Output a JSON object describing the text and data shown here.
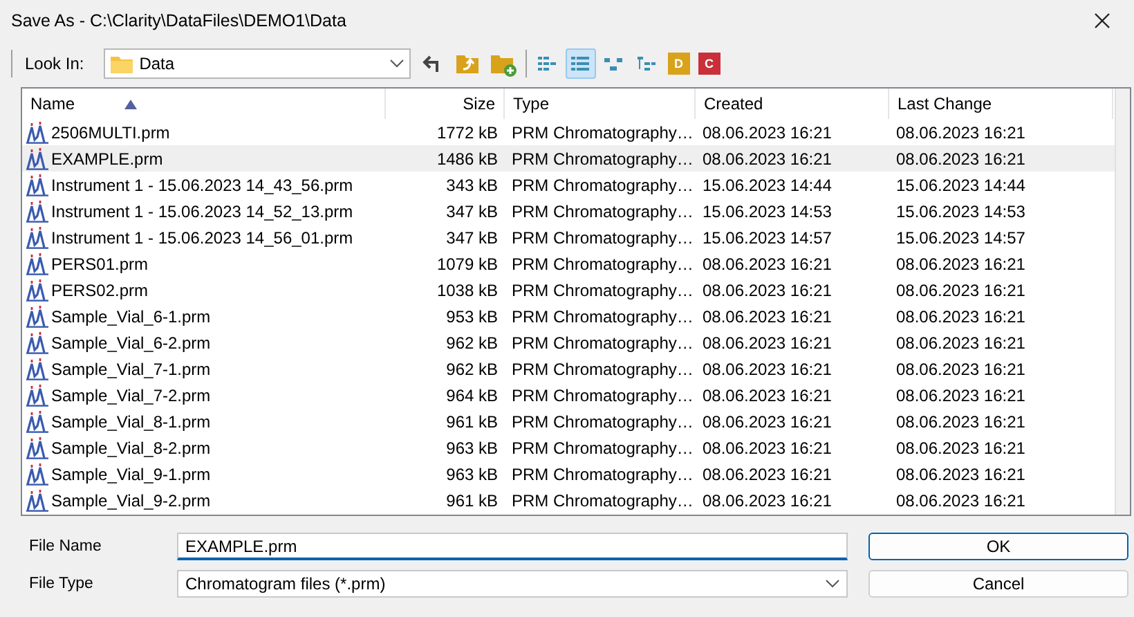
{
  "window": {
    "title": "Save As - C:\\Clarity\\DataFiles\\DEMO1\\Data"
  },
  "toolbar": {
    "look_in_label": "Look In:",
    "look_in_value": "Data",
    "view_buttons": [
      {
        "selected": false
      },
      {
        "selected": true
      },
      {
        "selected": false
      },
      {
        "selected": false
      }
    ],
    "letter_buttons": [
      {
        "label": "D",
        "color": "#d9a21b"
      },
      {
        "label": "C",
        "color": "#c9303a"
      }
    ]
  },
  "table": {
    "columns": [
      {
        "label": "Name",
        "sorted": true
      },
      {
        "label": "Size",
        "sorted": false
      },
      {
        "label": "Type",
        "sorted": false
      },
      {
        "label": "Created",
        "sorted": false
      },
      {
        "label": "Last Change",
        "sorted": false
      }
    ],
    "rows": [
      {
        "name": "2506MULTI.prm",
        "size": "1772 kB",
        "type": "PRM Chromatography…",
        "created": "08.06.2023 16:21",
        "changed": "08.06.2023 16:21",
        "selected": false
      },
      {
        "name": "EXAMPLE.prm",
        "size": "1486 kB",
        "type": "PRM Chromatography…",
        "created": "08.06.2023 16:21",
        "changed": "08.06.2023 16:21",
        "selected": true
      },
      {
        "name": "Instrument 1 - 15.06.2023 14_43_56.prm",
        "size": "343 kB",
        "type": "PRM Chromatography…",
        "created": "15.06.2023 14:44",
        "changed": "15.06.2023 14:44",
        "selected": false
      },
      {
        "name": "Instrument 1 - 15.06.2023 14_52_13.prm",
        "size": "347 kB",
        "type": "PRM Chromatography…",
        "created": "15.06.2023 14:53",
        "changed": "15.06.2023 14:53",
        "selected": false
      },
      {
        "name": "Instrument 1 - 15.06.2023 14_56_01.prm",
        "size": "347 kB",
        "type": "PRM Chromatography…",
        "created": "15.06.2023 14:57",
        "changed": "15.06.2023 14:57",
        "selected": false
      },
      {
        "name": "PERS01.prm",
        "size": "1079 kB",
        "type": "PRM Chromatography…",
        "created": "08.06.2023 16:21",
        "changed": "08.06.2023 16:21",
        "selected": false
      },
      {
        "name": "PERS02.prm",
        "size": "1038 kB",
        "type": "PRM Chromatography…",
        "created": "08.06.2023 16:21",
        "changed": "08.06.2023 16:21",
        "selected": false
      },
      {
        "name": "Sample_Vial_6-1.prm",
        "size": "953 kB",
        "type": "PRM Chromatography…",
        "created": "08.06.2023 16:21",
        "changed": "08.06.2023 16:21",
        "selected": false
      },
      {
        "name": "Sample_Vial_6-2.prm",
        "size": "962 kB",
        "type": "PRM Chromatography…",
        "created": "08.06.2023 16:21",
        "changed": "08.06.2023 16:21",
        "selected": false
      },
      {
        "name": "Sample_Vial_7-1.prm",
        "size": "962 kB",
        "type": "PRM Chromatography…",
        "created": "08.06.2023 16:21",
        "changed": "08.06.2023 16:21",
        "selected": false
      },
      {
        "name": "Sample_Vial_7-2.prm",
        "size": "964 kB",
        "type": "PRM Chromatography…",
        "created": "08.06.2023 16:21",
        "changed": "08.06.2023 16:21",
        "selected": false
      },
      {
        "name": "Sample_Vial_8-1.prm",
        "size": "961 kB",
        "type": "PRM Chromatography…",
        "created": "08.06.2023 16:21",
        "changed": "08.06.2023 16:21",
        "selected": false
      },
      {
        "name": "Sample_Vial_8-2.prm",
        "size": "963 kB",
        "type": "PRM Chromatography…",
        "created": "08.06.2023 16:21",
        "changed": "08.06.2023 16:21",
        "selected": false
      },
      {
        "name": "Sample_Vial_9-1.prm",
        "size": "963 kB",
        "type": "PRM Chromatography…",
        "created": "08.06.2023 16:21",
        "changed": "08.06.2023 16:21",
        "selected": false
      },
      {
        "name": "Sample_Vial_9-2.prm",
        "size": "961 kB",
        "type": "PRM Chromatography…",
        "created": "08.06.2023 16:21",
        "changed": "08.06.2023 16:21",
        "selected": false
      }
    ]
  },
  "form": {
    "file_name_label": "File Name",
    "file_name_value": "EXAMPLE.prm",
    "file_type_label": "File Type",
    "file_type_value": "Chromatogram files (*.prm)"
  },
  "buttons": [
    {
      "label": "OK",
      "default": true
    },
    {
      "label": "Cancel",
      "default": false
    }
  ]
}
